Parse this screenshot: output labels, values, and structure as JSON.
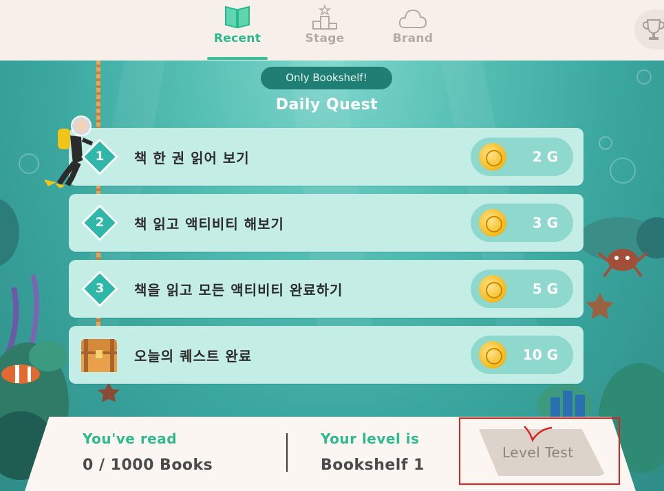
{
  "nav": {
    "tabs": [
      {
        "label": "Recent",
        "icon": "book-icon",
        "active": true
      },
      {
        "label": "Stage",
        "icon": "podium-icon",
        "active": false
      },
      {
        "label": "Brand",
        "icon": "cloud-icon",
        "active": false
      }
    ],
    "trophy_icon": "trophy-icon"
  },
  "quest": {
    "badge": "Only Bookshelf!",
    "title": "Daily Quest",
    "items": [
      {
        "num": "1",
        "text": "책 한 권 읽어 보기",
        "reward": "2 G"
      },
      {
        "num": "2",
        "text": "책 읽고 액티비티 해보기",
        "reward": "3 G"
      },
      {
        "num": "3",
        "text": "책을 읽고 모든 액티비티 완료하기",
        "reward": "5 G"
      },
      {
        "num": "",
        "text": "오늘의 퀘스트 완료",
        "reward": "10 G",
        "icon": "treasure-chest-icon"
      }
    ]
  },
  "stats": {
    "read_label": "You've read",
    "read_value": "0 / 1000 Books",
    "level_label": "Your level is",
    "level_value": "Bookshelf 1",
    "level_test_label": "Level Test"
  },
  "colors": {
    "accent": "#27b98b",
    "card": "#c4ede6",
    "annotation": "#e21d1d"
  }
}
